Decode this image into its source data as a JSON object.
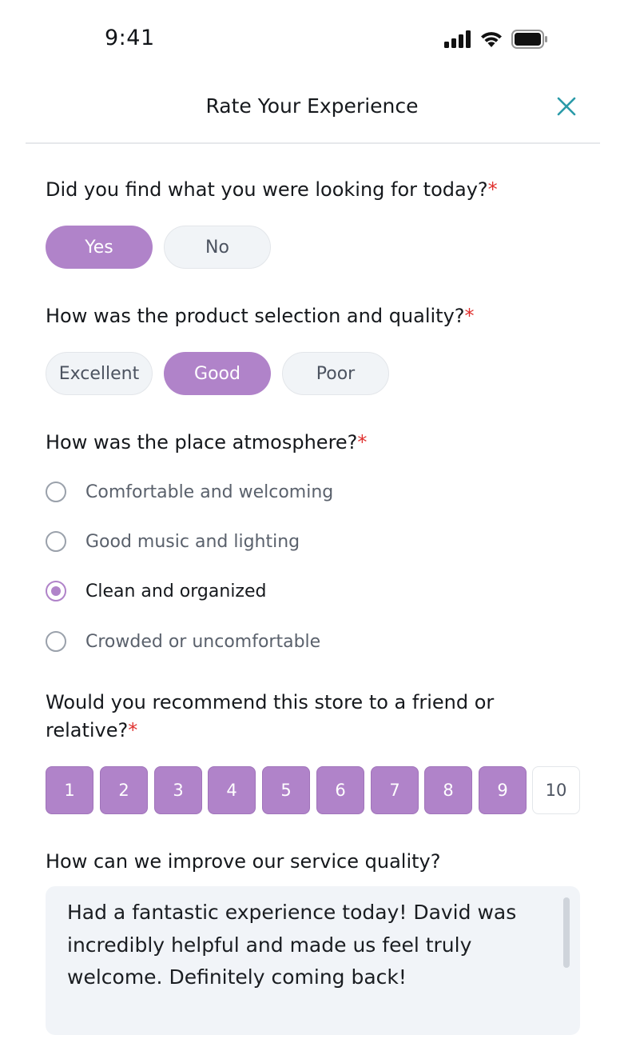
{
  "status_bar": {
    "time": "9:41"
  },
  "header": {
    "title": "Rate Your Experience"
  },
  "q1": {
    "text": "Did you find what you were looking for today?",
    "required_mark": "*",
    "options": [
      "Yes",
      "No"
    ],
    "selected": "Yes"
  },
  "q2": {
    "text": "How was the product selection and quality?",
    "required_mark": "*",
    "options": [
      "Excellent",
      "Good",
      "Poor"
    ],
    "selected": "Good"
  },
  "q3": {
    "text": "How was the place atmosphere?",
    "required_mark": "*",
    "options": [
      "Comfortable and welcoming",
      "Good music and lighting",
      "Clean and organized",
      "Crowded or uncomfortable"
    ],
    "selected": "Clean and organized"
  },
  "q4": {
    "text_line1": "Would you recommend this store to a friend or",
    "text_line2": "relative?",
    "required_mark": "*",
    "scale": [
      "1",
      "2",
      "3",
      "4",
      "5",
      "6",
      "7",
      "8",
      "9",
      "10"
    ],
    "selected": "9"
  },
  "q5": {
    "text": "How can we improve our service quality?",
    "answer": "Had a fantastic experience today! David was incredibly helpful and made us feel truly welcome. Definitely coming back!"
  },
  "colors": {
    "accent": "#b083c9",
    "required": "#e0312f",
    "close_icon": "#2a9aa8",
    "unselected_bg": "#f1f4f7"
  },
  "icons": [
    "signal-icon",
    "wifi-icon",
    "battery-icon",
    "close-icon"
  ]
}
